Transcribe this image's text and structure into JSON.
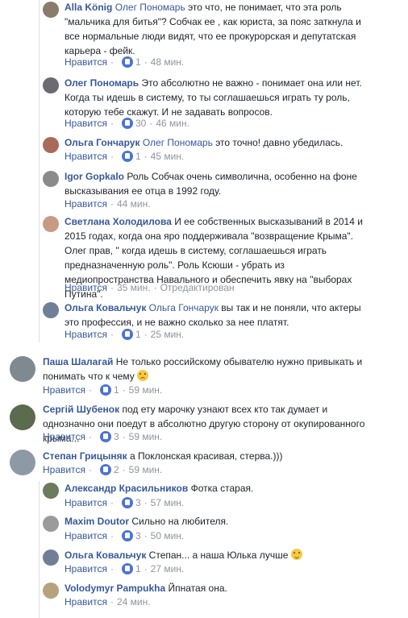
{
  "like_label": "Нравится",
  "separator": "·",
  "comments": [
    {
      "name": "Alla König",
      "mention": "Олег Пономарь",
      "text": " это что, не понимает, что эта роль \"мальчика для битья\"? Собчак ее , как юриста, за пояс заткнула и все нормальные люди видят, что ее прокурорская и депутатская карьера - фейк.",
      "likes": "1",
      "time": "48 мин.",
      "edited": ""
    },
    {
      "name": "Олег Пономарь",
      "mention": "",
      "text": "Это абсолютно не важно - понимает она или нет. Когда ты идешь в систему, то ты соглашаешься играть ту роль, которую тебе скажут. И не задавать вопросов.",
      "likes": "30",
      "time": "46 мин.",
      "edited": ""
    },
    {
      "name": "Ольга Гончарук",
      "mention": "Олег Пономарь",
      "text": " это точно! давно убедилась.",
      "likes": "1",
      "time": "45 мин.",
      "edited": ""
    },
    {
      "name": "Igor Gopkalo",
      "mention": "",
      "text": "Роль Собчак очень символична, особенно на фоне высказывания ее отца в 1992 году.",
      "likes": "",
      "time": "44 мин.",
      "edited": ""
    },
    {
      "name": "Светлана Холодилова",
      "mention": "",
      "text": "И ее собственных высказываний в 2014 и 2015 годах, когда она яро поддерживала \"возвращение Крыма\". Олег прав, \" когда идешь в систему, соглашаешься играть предназначенную роль\". Роль Ксюши - убрать из медиопространства Навального и обеспечить явку на \"выборах Путина\".",
      "likes": "",
      "time": "35 мин.",
      "edited": "Отредактирован"
    },
    {
      "name": "Ольга Ковальчук",
      "mention": "Ольга Гончарук",
      "text": " вы так и не поняли, что актеры это профессия, и не важно сколько за нее платят.",
      "likes": "1",
      "time": "25 мин.",
      "edited": ""
    },
    {
      "name": "Паша Шалагай",
      "mention": "",
      "text": "Не только российскому обывателю нужно привыкать и понимать что к чему",
      "likes": "1",
      "time": "59 мин.",
      "edited": ""
    },
    {
      "name": "Сергій Шубенок",
      "mention": "",
      "text": "под ету марочку узнают всех кто так думает и однозначно они поедут в абсолютно другую сторону от окупированного крыма...",
      "likes": "3",
      "time": "59 мин.",
      "edited": ""
    },
    {
      "name": "Степан Грицыняк",
      "mention": "",
      "text": "а Поклонская красивая, стерва.)))",
      "likes": "2",
      "time": "59 мин.",
      "edited": ""
    },
    {
      "name": "Александр Красильников",
      "mention": "",
      "text": "Фотка старая.",
      "likes": "3",
      "time": "57 мин.",
      "edited": ""
    },
    {
      "name": "Maxim Doutor",
      "mention": "",
      "text": "Сильно на любителя.",
      "likes": "3",
      "time": "50 мин.",
      "edited": ""
    },
    {
      "name": "Ольга Ковальчук",
      "mention": "",
      "text": "Степан... а наша Юлька лучше",
      "likes": "1",
      "time": "27 мин.",
      "edited": ""
    },
    {
      "name": "Volodymyr Pampukha",
      "mention": "",
      "text": "Йпнатая она.",
      "likes": "",
      "time": "24 мин.",
      "edited": ""
    }
  ],
  "colors": {
    "link": "#385898",
    "meta": "#90949c",
    "like_badge": "#4a73d4"
  },
  "icons": {
    "like": "like-thumb-icon",
    "smile": "smile-emoji-icon",
    "sad": "sad-emoji-icon"
  }
}
